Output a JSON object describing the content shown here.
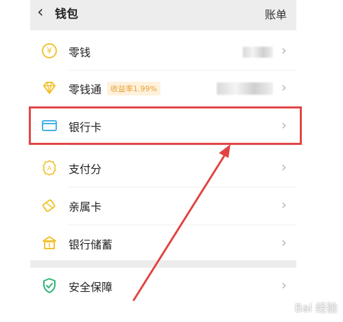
{
  "header": {
    "title": "钱包",
    "bill_label": "账单"
  },
  "items": [
    {
      "label": "零钱"
    },
    {
      "label": "零钱通",
      "badge": "收益率1.99%"
    },
    {
      "label": "银行卡"
    },
    {
      "label": "支付分"
    },
    {
      "label": "亲属卡"
    },
    {
      "label": "银行储蓄"
    },
    {
      "label": "安全保障"
    }
  ],
  "watermark": "Bai 经验",
  "colors": {
    "accent_yellow": "#f2c230",
    "accent_blue": "#3fb0e6",
    "accent_green": "#2bb673",
    "highlight_red": "#e24444",
    "badge_text": "#e7a234",
    "badge_bg": "#fff1dc"
  }
}
